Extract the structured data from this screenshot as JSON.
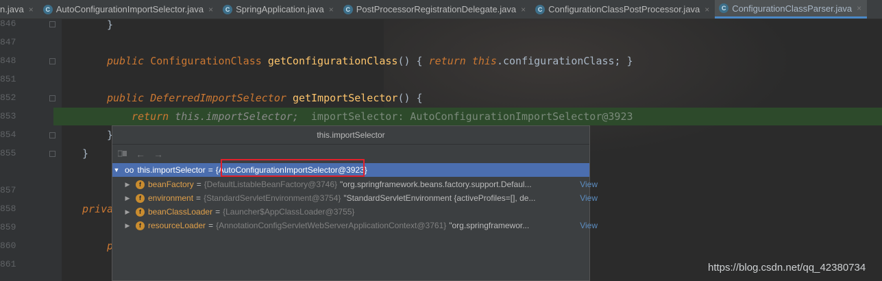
{
  "tabs": [
    {
      "label": "n.java",
      "icon": "",
      "active": false
    },
    {
      "label": "AutoConfigurationImportSelector.java",
      "icon": "C",
      "active": false
    },
    {
      "label": "SpringApplication.java",
      "icon": "C",
      "active": false
    },
    {
      "label": "PostProcessorRegistrationDelegate.java",
      "icon": "C",
      "active": false
    },
    {
      "label": "ConfigurationClassPostProcessor.java",
      "icon": "C",
      "active": false
    },
    {
      "label": "ConfigurationClassParser.java",
      "icon": "C",
      "active": true
    }
  ],
  "close_glyph": "×",
  "line_numbers": [
    "846",
    "847",
    "848",
    "851",
    "852",
    "853",
    "854",
    "855",
    "857",
    "858",
    "859",
    "860",
    "861"
  ],
  "code": {
    "l846": "}",
    "l848_kw": "public",
    "l848_type": "ConfigurationClass",
    "l848_fn": "getConfigurationClass",
    "l848_mid": "() { ",
    "l848_ret": "return",
    "l848_this": "this",
    "l848_rest": ".configurationClass; }",
    "l852_kw": "public",
    "l852_type": "DeferredImportSelector",
    "l852_fn": "getImportSelector",
    "l852_rest": "() {",
    "l853_ret": "return",
    "l853_this": "this.importSelector;",
    "l853_hint": "importSelector: AutoConfigurationImportSelector@3923",
    "l854": "}",
    "l855": "}",
    "l858": "priva",
    "l860": "p"
  },
  "popup": {
    "title": "this.importSelector",
    "root": {
      "name": "this.importSelector",
      "eq": "=",
      "value": "{AutoConfigurationImportSelector@3923}"
    },
    "children": [
      {
        "name": "beanFactory",
        "eq": "=",
        "value": "{DefaultListableBeanFactory@3746}",
        "str": "\"org.springframework.beans.factory.support.Defaul...",
        "view": "View"
      },
      {
        "name": "environment",
        "eq": "=",
        "value": "{StandardServletEnvironment@3754}",
        "str": "\"StandardServletEnvironment {activeProfiles=[], de...",
        "view": "View"
      },
      {
        "name": "beanClassLoader",
        "eq": "=",
        "value": "{Launcher$AppClassLoader@3755}",
        "str": "",
        "view": ""
      },
      {
        "name": "resourceLoader",
        "eq": "=",
        "value": "{AnnotationConfigServletWebServerApplicationContext@3761}",
        "str": "\"org.springframewor...",
        "view": "View"
      }
    ],
    "field_icon_letter": "f"
  },
  "watermark": "https://blog.csdn.net/qq_42380734"
}
